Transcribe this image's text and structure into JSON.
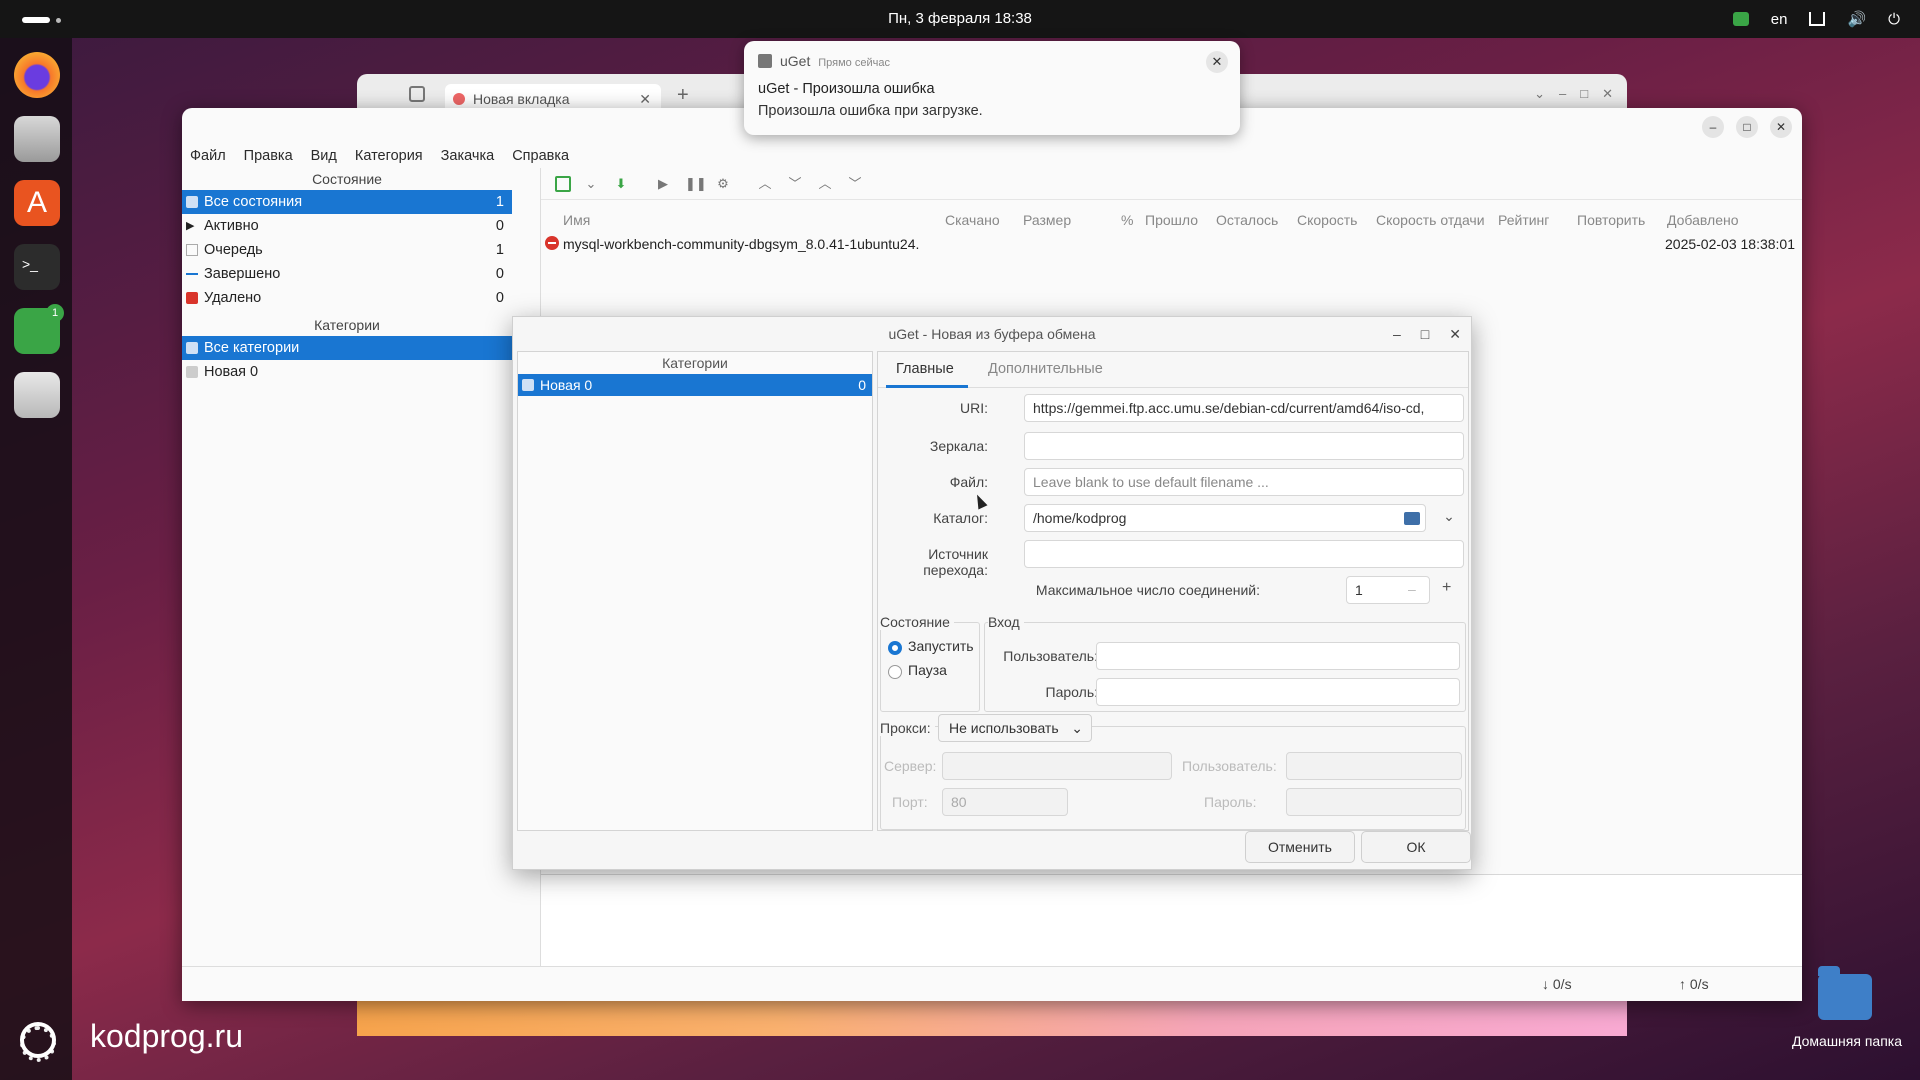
{
  "topbar": {
    "clock": "Пн, 3 февраля  18:38",
    "lang": "en"
  },
  "browser": {
    "tab_title": "Новая вкладка"
  },
  "notification": {
    "app": "uGet",
    "time": "Прямо сейчас",
    "title": "uGet - Произошла ошибка",
    "body": "Произошла ошибка при загрузке."
  },
  "menu": [
    "Файл",
    "Правка",
    "Вид",
    "Категория",
    "Закачка",
    "Справка"
  ],
  "state_header": "Состояние",
  "states": [
    {
      "label": "Все состояния",
      "count": "1"
    },
    {
      "label": "Активно",
      "count": "0"
    },
    {
      "label": "Очередь",
      "count": "1"
    },
    {
      "label": "Завершено",
      "count": "0"
    },
    {
      "label": "Удалено",
      "count": "0"
    }
  ],
  "categories_header": "Категории",
  "categories": [
    {
      "label": "Все категории"
    },
    {
      "label": "Новая 0"
    }
  ],
  "columns": [
    "Имя",
    "Скачано",
    "Размер",
    "%",
    "Прошло",
    "Осталось",
    "Скорость",
    "Скорость отдачи",
    "Рейтинг",
    "Повторить",
    "Добавлено"
  ],
  "download": {
    "name": "mysql-workbench-community-dbgsym_8.0.41-1ubuntu24.",
    "added": "2025-02-03 18:38:01"
  },
  "statusbar": {
    "down": "↓ 0/s",
    "up": "↑ 0/s"
  },
  "dialog": {
    "title": "uGet - Новая из буфера обмена",
    "cat_header": "Категории",
    "cat_item": "Новая 0",
    "cat_count": "0",
    "tab_main": "Главные",
    "tab_extra": "Дополнительные",
    "uri_label": "URI:",
    "uri_value": "https://gemmei.ftp.acc.umu.se/debian-cd/current/amd64/iso-cd,",
    "mirrors_label": "Зеркала:",
    "file_label": "Файл:",
    "file_placeholder": "Leave blank to use default filename ...",
    "folder_label": "Каталог:",
    "folder_value": "/home/kodprog",
    "referrer_label": "Источник перехода:",
    "maxconn_label": "Максимальное число соединений:",
    "maxconn_value": "1",
    "state_group": "Состояние",
    "state_start": "Запустить",
    "state_pause": "Пауза",
    "login_group": "Вход",
    "user_label": "Пользователь:",
    "pass_label": "Пароль:",
    "proxy_label": "Прокси:",
    "proxy_value": "Не использовать",
    "server_label": "Сервер:",
    "proxy_user_label": "Пользователь:",
    "port_label": "Порт:",
    "port_value": "80",
    "proxy_pass_label": "Пароль:",
    "cancel": "Отменить",
    "ok": "ОК"
  },
  "desktop": {
    "watermark": "kodprog.ru",
    "home_label": "Домашняя папка"
  },
  "dock_badge": "1",
  "colors": {
    "accent": "#1976d2",
    "error": "#d9342b"
  }
}
